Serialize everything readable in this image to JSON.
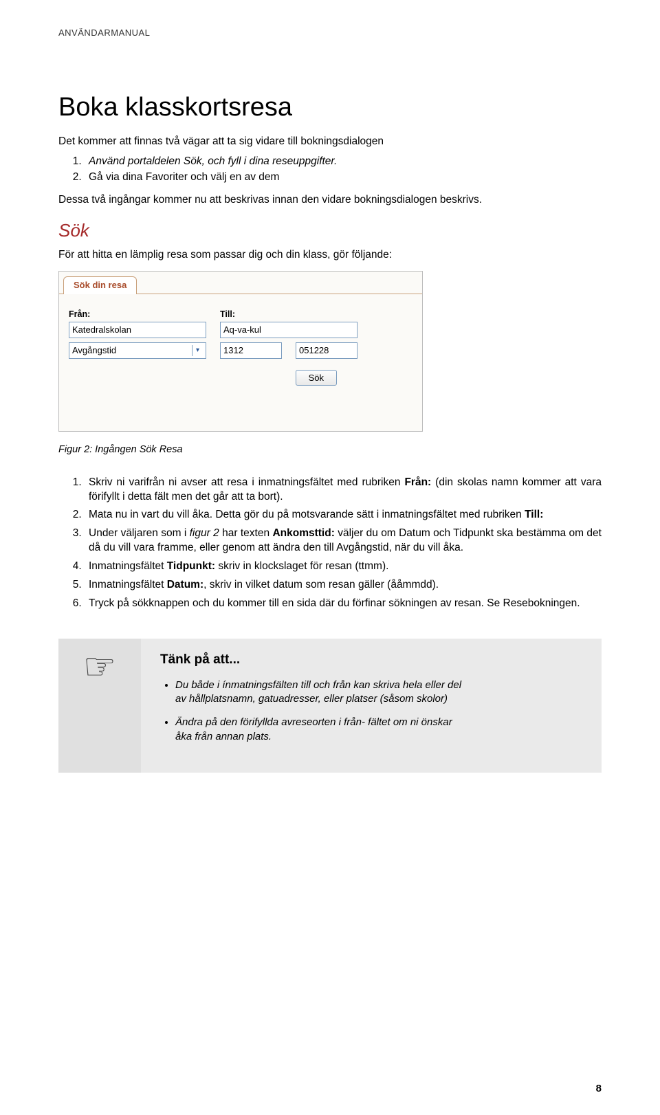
{
  "header": "ANVÄNDARMANUAL",
  "h1": "Boka klasskortsresa",
  "intro_p": "Det kommer att finnas två vägar att ta sig vidare till bokningsdialogen",
  "intro_list": [
    "Använd portaldelen Sök, och fyll i dina reseuppgifter.",
    "Gå via dina Favoriter och välj en av dem"
  ],
  "intro_p2": "Dessa två ingångar kommer nu att beskrivas innan den vidare bokningsdialogen beskrivs.",
  "sok_h2": "Sök",
  "sok_intro": "För att hitta en lämplig resa som passar dig och din klass, gör följande:",
  "panel": {
    "tab": "Sök din resa",
    "from_label": "Från:",
    "from_value": "Katedralskolan",
    "till_label": "Till:",
    "till_value": "Aq-va-kul",
    "select_value": "Avgångstid",
    "time_value": "1312",
    "date_value": "051228",
    "search_btn": "Sök"
  },
  "caption": "Figur 2: Ingången Sök Resa",
  "steps": [
    {
      "pre": "Skriv ni varifrån ni avser att resa i inmatningsfältet med rubriken ",
      "b": "Från:",
      "post": " (din skolas namn kommer att vara förifyllt i detta fält men det går att ta bort)."
    },
    {
      "pre": "Mata nu in vart du vill åka. Detta gör du på motsvarande sätt i inmatningsfältet med rubriken ",
      "b": "Till:",
      "post": ""
    },
    {
      "pre": "Under väljaren som i ",
      "i": "figur 2",
      "mid": " har texten ",
      "b": "Ankomsttid:",
      "post": " väljer du om Datum och Tidpunkt ska bestämma om det då du vill vara framme, eller genom att ändra den till Avgångstid, när du vill åka."
    },
    {
      "pre": "Inmatningsfältet ",
      "b": "Tidpunkt:",
      "post": " skriv in klockslaget för resan (ttmm)."
    },
    {
      "pre": "Inmatningsfältet ",
      "b": "Datum:",
      "post": ", skriv in vilket datum som resan gäller (ååmmdd)."
    },
    {
      "pre": "Tryck på sökknappen och du kommer till en sida där du förfinar sökningen av resan. Se Resebokningen.",
      "b": "",
      "post": ""
    }
  ],
  "callout": {
    "title": "Tänk på att...",
    "items": [
      "Du både i ínmatningsfälten till och från kan skriva hela eller del av hållplatsnamn, gatuadresser, eller platser (såsom skolor)",
      "Ändra på den förifyllda avreseorten i från- fältet om ni önskar åka från annan plats."
    ]
  },
  "page_number": "8"
}
